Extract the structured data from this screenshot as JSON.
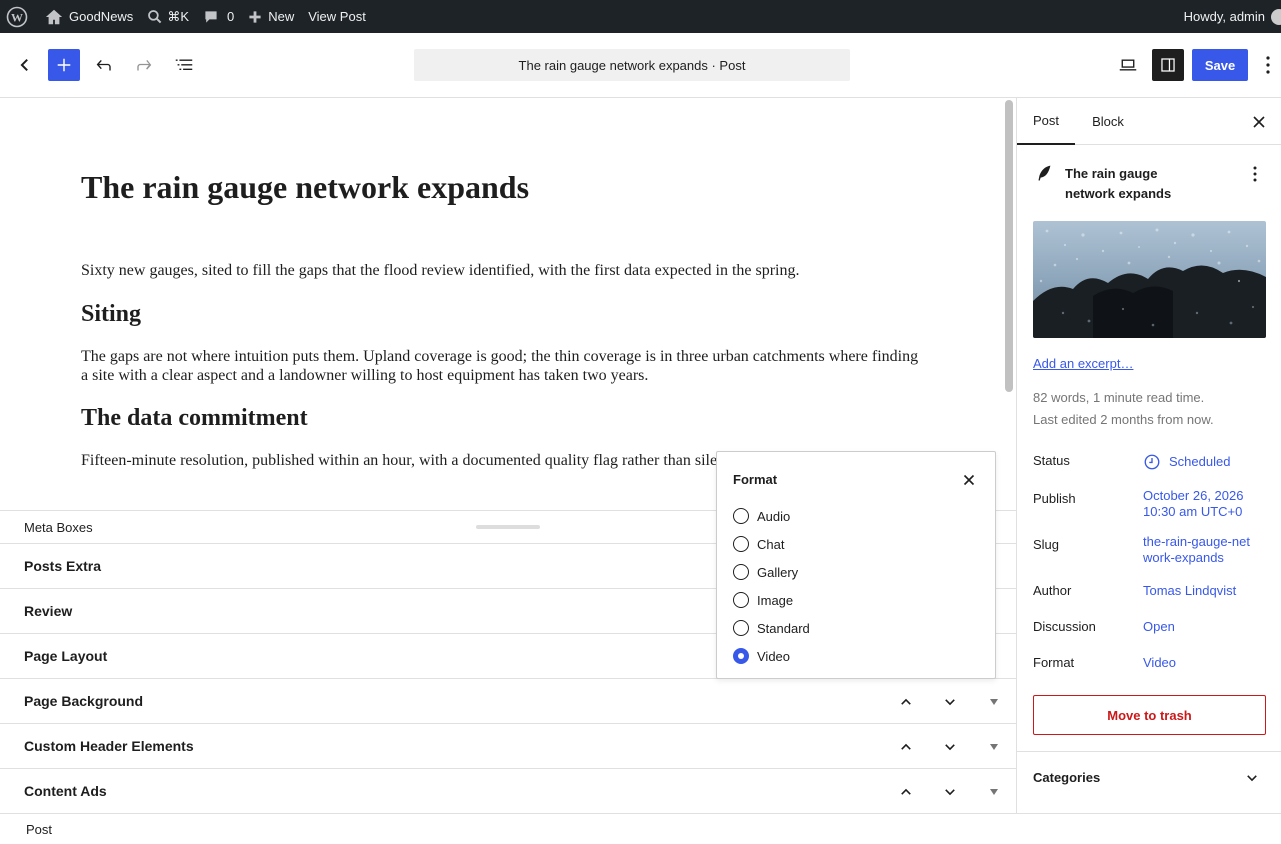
{
  "admin_bar": {
    "site_name": "GoodNews",
    "search_shortcut": "⌘K",
    "comments_count": "0",
    "new_label": "New",
    "view_post_label": "View Post",
    "howdy_label": "Howdy, admin"
  },
  "toolbar": {
    "document_title": "The rain gauge network expands · Post",
    "save_label": "Save"
  },
  "editor": {
    "title": "The rain gauge network expands",
    "blocks": [
      {
        "type": "paragraph",
        "text": "Sixty new gauges, sited to fill the gaps that the flood review identified, with the first data expected in the spring."
      },
      {
        "type": "heading",
        "text": "Siting"
      },
      {
        "type": "paragraph",
        "text": "The gaps are not where intuition puts them. Upland coverage is good; the thin coverage is in three urban catchments where finding a site with a clear aspect and a landowner willing to host equipment has taken two years."
      },
      {
        "type": "heading",
        "text": "The data commitment"
      },
      {
        "type": "paragraph",
        "text": "Fifteen-minute resolution, published within an hour, with a documented quality flag rather than silent"
      }
    ]
  },
  "meta_boxes": {
    "header": "Meta Boxes",
    "items": [
      "Posts Extra",
      "Review",
      "Page Layout",
      "Page Background",
      "Custom Header Elements",
      "Content Ads"
    ]
  },
  "footer": {
    "breadcrumb": "Post"
  },
  "sidebar": {
    "tabs": [
      "Post",
      "Block"
    ],
    "post_title": "The rain gauge network expands",
    "excerpt_link": "Add an excerpt…",
    "word_count": "82 words, 1 minute read time.",
    "last_edited": "Last edited 2 months from now.",
    "properties": {
      "status_label": "Status",
      "status_value": "Scheduled",
      "publish_label": "Publish",
      "publish_value": "October 26, 2026 10:30 am UTC+0",
      "slug_label": "Slug",
      "slug_value": "the-rain-gauge-network-expands",
      "author_label": "Author",
      "author_value": "Tomas Lindqvist",
      "discussion_label": "Discussion",
      "discussion_value": "Open",
      "format_label": "Format",
      "format_value": "Video"
    },
    "trash_label": "Move to trash",
    "categories_label": "Categories"
  },
  "format_popover": {
    "title": "Format",
    "options": [
      "Audio",
      "Chat",
      "Gallery",
      "Image",
      "Standard",
      "Video"
    ],
    "selected": "Video"
  },
  "colors": {
    "accent": "#3858e9",
    "danger": "#cc1818",
    "admin_bar": "#1d2327"
  }
}
